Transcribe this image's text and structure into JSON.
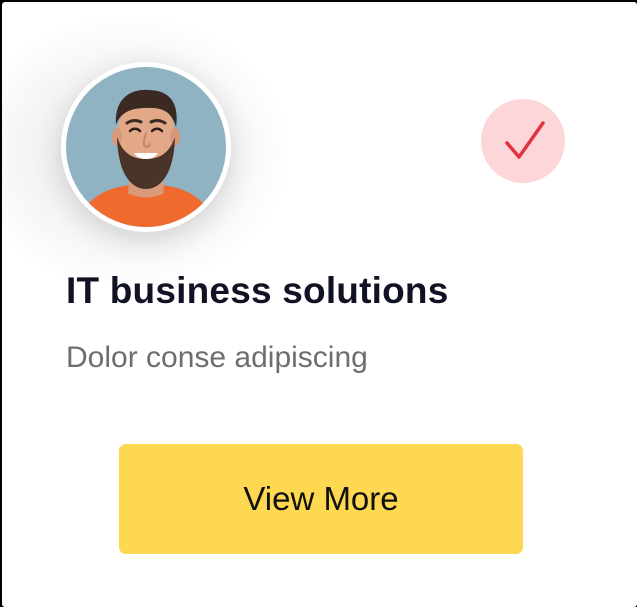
{
  "card": {
    "title": "IT business solutions",
    "subtitle": "Dolor conse adipiscing",
    "button_label": "View More",
    "avatar_icon": "person-photo",
    "status_icon": "checkmark-icon"
  },
  "colors": {
    "button_background": "#fdd850",
    "check_badge_background": "#fcd6d9",
    "check_mark": "#e2323f",
    "title_text": "#111325",
    "subtitle_text": "#6e6e6e"
  }
}
